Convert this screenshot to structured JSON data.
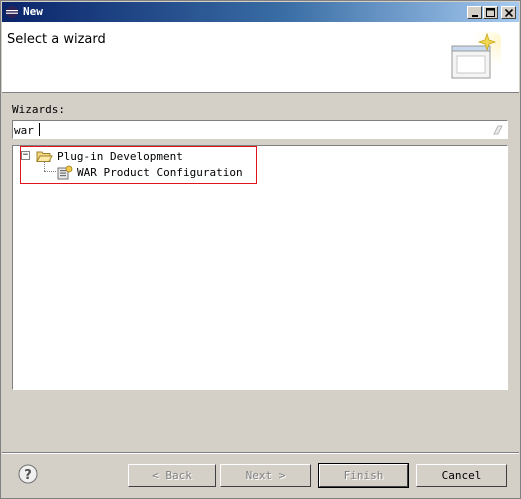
{
  "window": {
    "title": "New"
  },
  "header": {
    "title": "Select a wizard"
  },
  "wizards": {
    "label": "Wizards:",
    "filter_value": "war"
  },
  "tree": {
    "items": [
      {
        "label": "Plug-in Development",
        "toggle": "−"
      },
      {
        "label": "WAR Product Configuration"
      }
    ]
  },
  "buttons": {
    "back": "< Back",
    "next": "Next >",
    "finish": "Finish",
    "cancel": "Cancel"
  },
  "colors": {
    "highlight": "#e0141e",
    "titlebar_start": "#0a246a",
    "titlebar_end": "#a6caf0"
  }
}
